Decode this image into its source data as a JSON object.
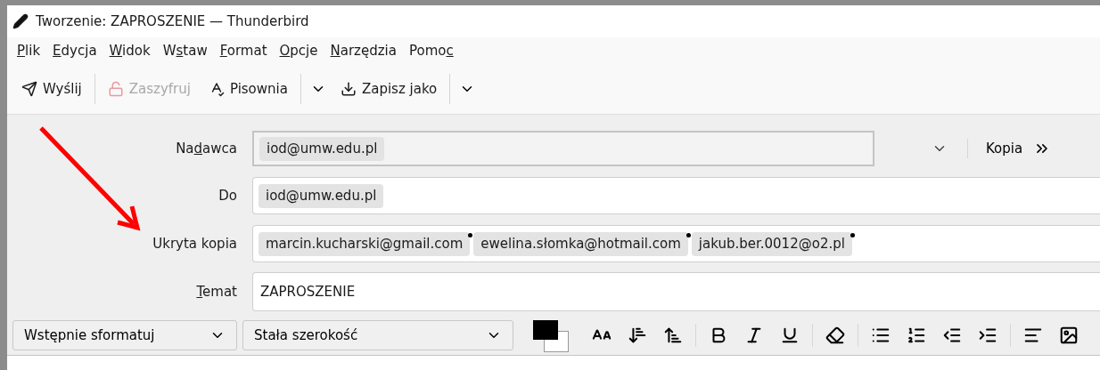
{
  "window": {
    "title": "Tworzenie: ZAPROSZENIE — Thunderbird"
  },
  "menu": [
    {
      "accel": "P",
      "rest": "lik"
    },
    {
      "accel": "E",
      "rest": "dycja"
    },
    {
      "accel": "W",
      "rest": "idok"
    },
    {
      "prefix": "W",
      "accel": "s",
      "rest": "taw"
    },
    {
      "accel": "F",
      "rest": "ormat"
    },
    {
      "accel": "O",
      "rest": "pcje"
    },
    {
      "accel": "N",
      "rest": "arzędzia"
    },
    {
      "prefix": "Pomo",
      "accel": "c"
    }
  ],
  "toolbar": [
    {
      "kind": "send",
      "label": "Wyślij",
      "disabled": false
    },
    {
      "kind": "encrypt",
      "label": "Zaszyfruj",
      "disabled": true
    },
    {
      "kind": "spell",
      "label": "Pisownia",
      "disabled": false,
      "dropdown": true
    },
    {
      "kind": "save",
      "label": "Zapisz jako",
      "disabled": false,
      "dropdown": true
    }
  ],
  "header": {
    "from": {
      "label": {
        "prefix": "Na",
        "accel": "d",
        "rest": "awca"
      },
      "value": "iod@umw.edu.pl",
      "extra": "Kopia"
    },
    "rows": [
      {
        "label": {
          "prefix": "Do"
        },
        "recipients": [
          {
            "address": "iod@umw.edu.pl",
            "flagged": false
          }
        ]
      },
      {
        "label": {
          "prefix": "Ukryta kopia"
        },
        "recipients": [
          {
            "address": "marcin.kucharski@gmail.com",
            "flagged": true
          },
          {
            "address": "ewelina.słomka@hotmail.com",
            "flagged": true
          },
          {
            "address": "jakub.ber.0012@o2.pl",
            "flagged": true
          }
        ]
      }
    ],
    "subject": {
      "label": {
        "accel": "T",
        "rest": "emat"
      },
      "value": "ZAPROSZENIE"
    }
  },
  "format_bar": {
    "paragraph": "Wstępnie sformatuj",
    "font": "Stała szerokość"
  }
}
